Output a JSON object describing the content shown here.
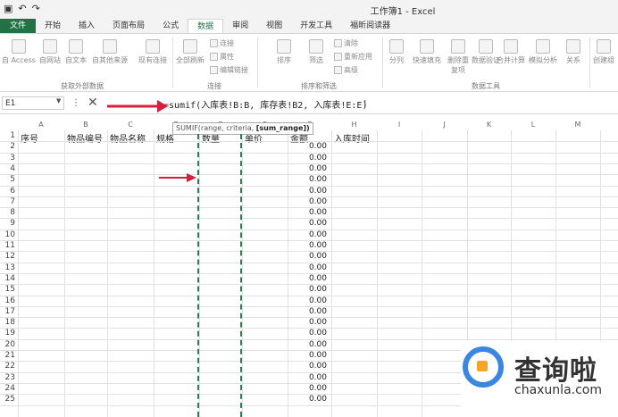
{
  "titlebar": {
    "title": "工作簿1 - Excel"
  },
  "tabs": [
    {
      "label": "文件"
    },
    {
      "label": "开始"
    },
    {
      "label": "插入"
    },
    {
      "label": "页面布局"
    },
    {
      "label": "公式"
    },
    {
      "label": "数据"
    },
    {
      "label": "审阅"
    },
    {
      "label": "视图"
    },
    {
      "label": "开发工具"
    },
    {
      "label": "福昕阅读器"
    }
  ],
  "ribbon": {
    "external_data": [
      "自 Access",
      "自网站",
      "自文本",
      "自其他来源",
      "现有连接"
    ],
    "refresh_all": "全部刷新",
    "connection_items": [
      "连接",
      "属性",
      "编辑链接"
    ],
    "sort": "排序",
    "filter": "筛选",
    "filter_items": [
      "清除",
      "重新应用",
      "高级"
    ],
    "tools": [
      "分列",
      "快速填充",
      "删除重复项",
      "数据验证",
      "合并计算",
      "模拟分析",
      "关系"
    ],
    "outline": "创建组",
    "groups": {
      "external": "获取外部数据",
      "connection": "连接",
      "sort_filter": "排序和筛选",
      "tools": "数据工具"
    }
  },
  "formula_bar": {
    "name_box": "E1",
    "formula": "=sumif(入库表!B:B, 库存表!B2, 入库表!E:E)",
    "tooltip_prefix": "SUMIF(range, criteria, ",
    "tooltip_bold": "[sum_range])"
  },
  "columns": [
    "A",
    "B",
    "C",
    "D",
    "E",
    "F",
    "G",
    "H",
    "I",
    "J",
    "K",
    "L",
    "M"
  ],
  "headers": {
    "A": "序号",
    "B": "物品编号",
    "C": "物品名称",
    "D": "规格",
    "E": "数量",
    "F": "单价",
    "G": "金额",
    "H": "入库时间"
  },
  "rows": [
    "1",
    "2",
    "3",
    "4",
    "5",
    "6",
    "7",
    "8",
    "9",
    "10",
    "11",
    "12",
    "13",
    "14",
    "15",
    "16",
    "17",
    "18",
    "19",
    "20",
    "21",
    "22",
    "23",
    "24",
    "25"
  ],
  "amount_values": [
    "0.00",
    "0.00",
    "0.00",
    "0.00",
    "0.00",
    "0.00",
    "0.00",
    "0.00",
    "0.00",
    "0.00",
    "0.00",
    "0.00",
    "0.00",
    "0.00",
    "0.00",
    "0.00",
    "0.00",
    "0.00",
    "0.00",
    "0.00",
    "0.00",
    "0.00",
    "0.00",
    "0.00"
  ],
  "watermark": {
    "brand": "查询啦",
    "url": "chaxunla.com"
  },
  "colors": {
    "accent": "#217346",
    "arrow": "#d81e3c",
    "dash": "#2e7d52"
  }
}
